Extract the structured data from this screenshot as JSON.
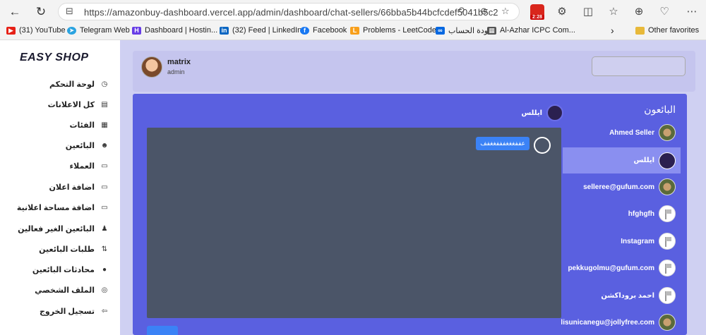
{
  "browser": {
    "url": "https://amazonbuy-dashboard.vercel.app/admin/dashboard/chat-sellers/66bba5b44bcfcdef5041b5c2",
    "extension_badge": "2:28",
    "bookmarks": [
      {
        "label": "(31) YouTube",
        "color": "#e62117"
      },
      {
        "label": "Telegram Web",
        "color": "#2aa3e0"
      },
      {
        "label": "Dashboard | Hostin...",
        "color": "#673de6"
      },
      {
        "label": "(32) Feed | LinkedIn",
        "color": "#0a66c2"
      },
      {
        "label": "Facebook",
        "color": "#1877f2"
      },
      {
        "label": "Problems - LeetCode",
        "color": "#f89f1b"
      },
      {
        "label": "جودة الحساب",
        "color": "#0668e1"
      },
      {
        "label": "Al-Azhar ICPC Com...",
        "color": "#555555"
      }
    ],
    "other_favorites": "Other favorites"
  },
  "sidebar": {
    "logo": "EASY SHOP",
    "items": [
      {
        "label": "لوحة التحكم",
        "icon": "dashboard-icon",
        "glyph": "◷"
      },
      {
        "label": "كل الاعلانات",
        "icon": "list-icon",
        "glyph": "▤"
      },
      {
        "label": "الفئات",
        "icon": "grid-icon",
        "glyph": "▦"
      },
      {
        "label": "البائعين",
        "icon": "users-icon",
        "glyph": "☻"
      },
      {
        "label": "العملاء",
        "icon": "card-icon",
        "glyph": "▭"
      },
      {
        "label": "اضافة اعلان",
        "icon": "card-icon",
        "glyph": "▭"
      },
      {
        "label": "اضافة مساحة اعلانية",
        "icon": "card-icon",
        "glyph": "▭"
      },
      {
        "label": "البائعين الغير فعالين",
        "icon": "user-x-icon",
        "glyph": "♟"
      },
      {
        "label": "طلبات البائعين",
        "icon": "request-icon",
        "glyph": "⇅"
      },
      {
        "label": "محادثات البائعين",
        "icon": "chat-icon",
        "glyph": "●"
      },
      {
        "label": "الملف الشخصي",
        "icon": "profile-icon",
        "glyph": "◎"
      },
      {
        "label": "تسجيل الخروج",
        "icon": "logout-icon",
        "glyph": "⇦"
      }
    ]
  },
  "header": {
    "user_name": "matrix",
    "user_role": "admin"
  },
  "panel": {
    "title": "البائعون",
    "current_chat": "ايللس",
    "message": "عففغغغفففغغفف",
    "sellers": [
      {
        "name": "Ahmed Seller",
        "avatar": "photo",
        "active": false
      },
      {
        "name": "ايللس",
        "avatar": "dark",
        "active": true
      },
      {
        "name": "selleree@gufum.com",
        "avatar": "photo",
        "active": false
      },
      {
        "name": "hfghgfh",
        "avatar": "flag",
        "active": false
      },
      {
        "name": "Instagram",
        "avatar": "flag",
        "active": false
      },
      {
        "name": "pekkugolmu@gufum.com",
        "avatar": "flag",
        "active": false
      },
      {
        "name": "احمد بروداكشن",
        "avatar": "flag",
        "active": false
      },
      {
        "name": "lisunicanegu@jollyfree.com",
        "avatar": "photo",
        "active": false
      }
    ]
  }
}
